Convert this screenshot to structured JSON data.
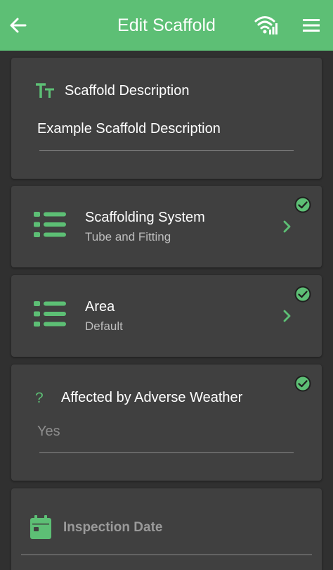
{
  "appbar": {
    "title": "Edit Scaffold",
    "back_icon": "arrow-left-icon",
    "status_icon": "wifi-signal-icon",
    "menu_icon": "hamburger-menu-icon",
    "background_color": "#5dbf75"
  },
  "description": {
    "label": "Scaffold Description",
    "value": "Example Scaffold Description",
    "icon": "text-format-icon"
  },
  "scaffolding_system": {
    "title": "Scaffolding System",
    "value": "Tube and Fitting",
    "icon": "list-icon",
    "status_icon": "check-circle-icon"
  },
  "area": {
    "title": "Area",
    "value": "Default",
    "icon": "list-icon",
    "status_icon": "check-circle-icon"
  },
  "adverse_weather": {
    "icon_glyph": "?",
    "label": "Affected by Adverse Weather",
    "value": "Yes",
    "status_icon": "check-circle-icon"
  },
  "inspection_date": {
    "label": "Inspection Date",
    "icon": "calendar-icon"
  },
  "colors": {
    "accent": "#5dbf75",
    "background": "#303030",
    "card": "#404040"
  }
}
